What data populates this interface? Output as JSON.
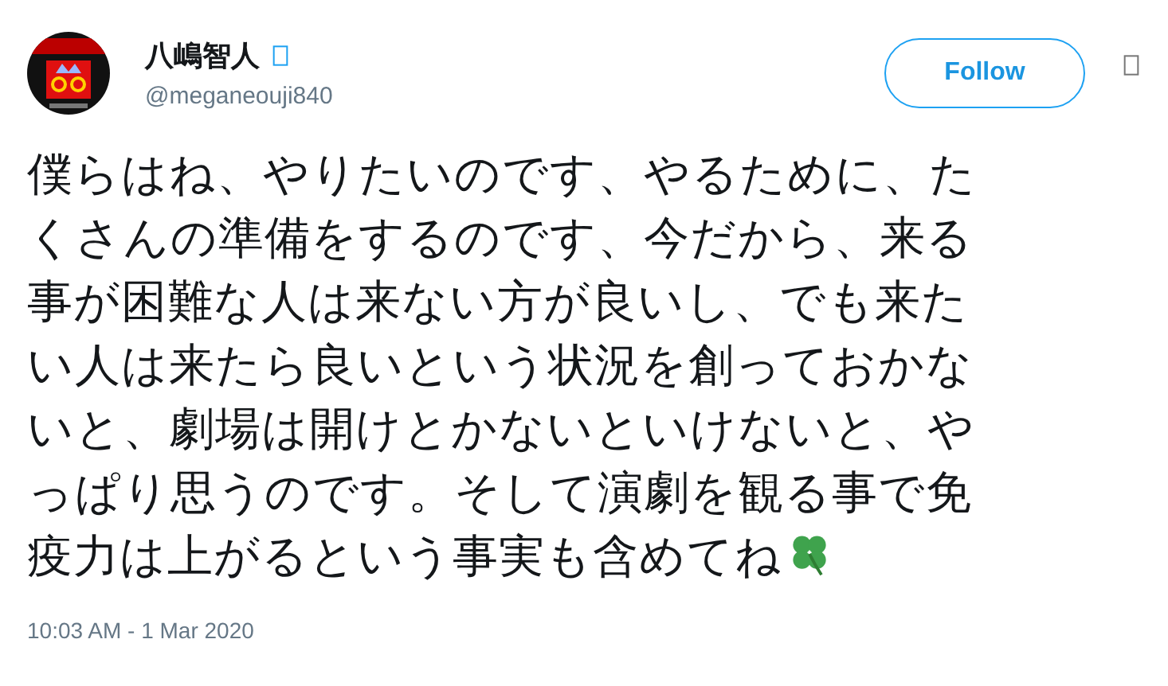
{
  "author": {
    "name": "八嶋智人",
    "handle": "@meganeouji840",
    "verified": true
  },
  "follow_button": {
    "label": "Follow"
  },
  "tweet": {
    "text": "僕らはね、やりたいのです、やるために、たくさんの準備をするのです、今だから、来る事が困難な人は来ない方が良いし、でも来たい人は来たら良いという状況を創っておかないと、劇場は開けとかないといけないと、やっぱり思うのです。そして演劇を観る事で免疫力は上がるという事実も含めてね"
  },
  "timestamp": "10:03 AM - 1 Mar 2020"
}
